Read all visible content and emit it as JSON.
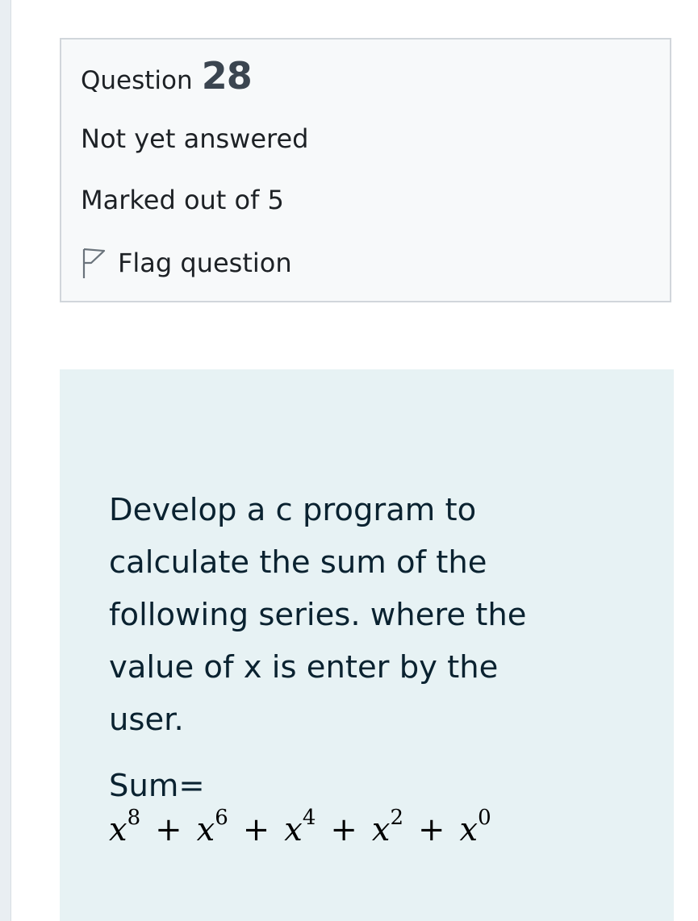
{
  "question_info": {
    "label": "Question",
    "number": "28",
    "state": "Not yet answered",
    "grade": "Marked out of 5",
    "flag_label": "Flag question"
  },
  "question_text": {
    "lines": [
      "Develop a c program to",
      "calculate the sum of the",
      "following series. where the",
      "value of x is enter by the",
      "user."
    ],
    "sum_label": "Sum=",
    "formula": {
      "variable": "x",
      "operator": "+",
      "exponents": [
        "8",
        "6",
        "4",
        "2",
        "0"
      ]
    }
  },
  "colors": {
    "info_bg": "#f7f9fa",
    "info_border": "#d1d6db",
    "question_bg": "#e7f2f4",
    "text_dark": "#0a2230"
  },
  "icons": {
    "flag": "flag-outline-icon"
  }
}
